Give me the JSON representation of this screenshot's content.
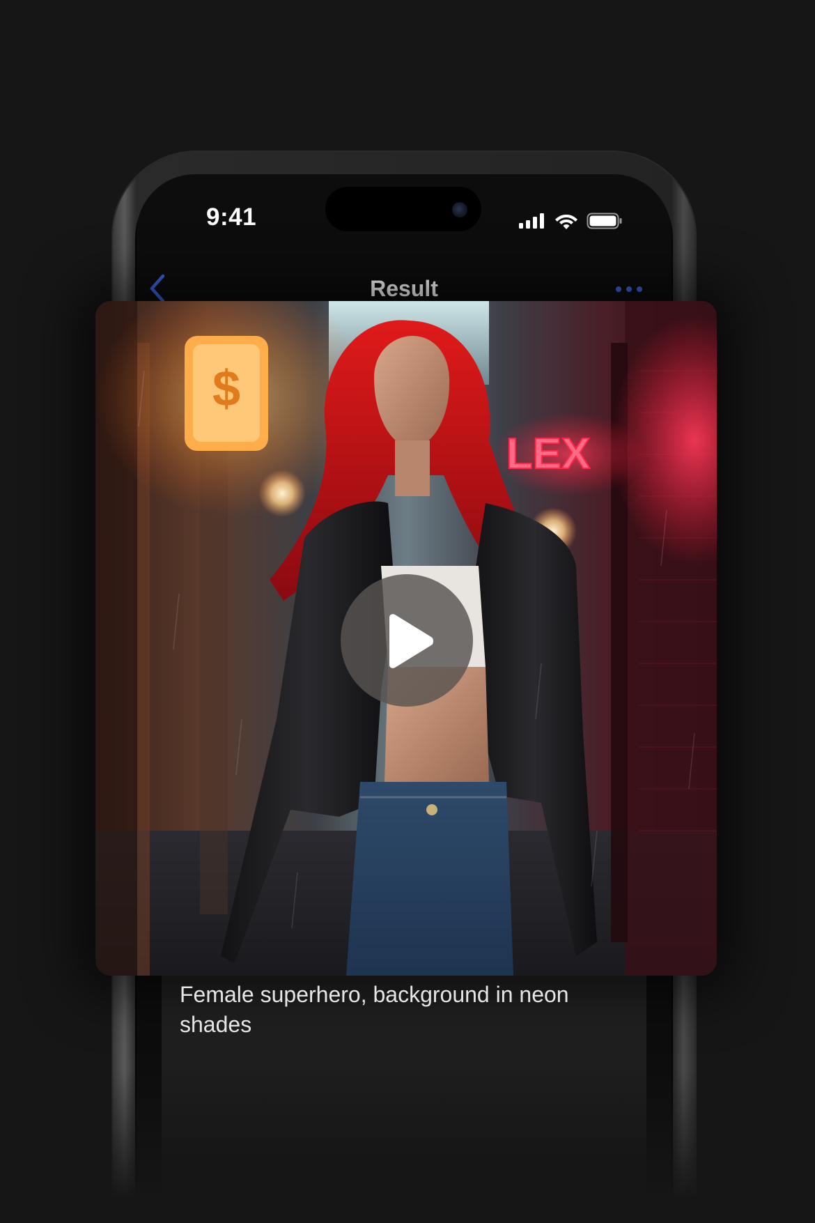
{
  "status_bar": {
    "time": "9:41",
    "icons": [
      "cellular-signal-icon",
      "wifi-icon",
      "battery-icon"
    ]
  },
  "nav": {
    "title": "Result",
    "back_icon": "chevron-left-icon",
    "more_icon": "ellipsis-icon",
    "accent_color": "#3a66e0"
  },
  "media": {
    "type": "video",
    "play_icon": "play-icon",
    "sign_text": "LEX",
    "lantern_text": "$"
  },
  "prompt": {
    "text": "Female superhero, background in neon shades"
  },
  "colors": {
    "background": "#161616",
    "text": "#e6e6e6",
    "title": "#ffffff"
  }
}
